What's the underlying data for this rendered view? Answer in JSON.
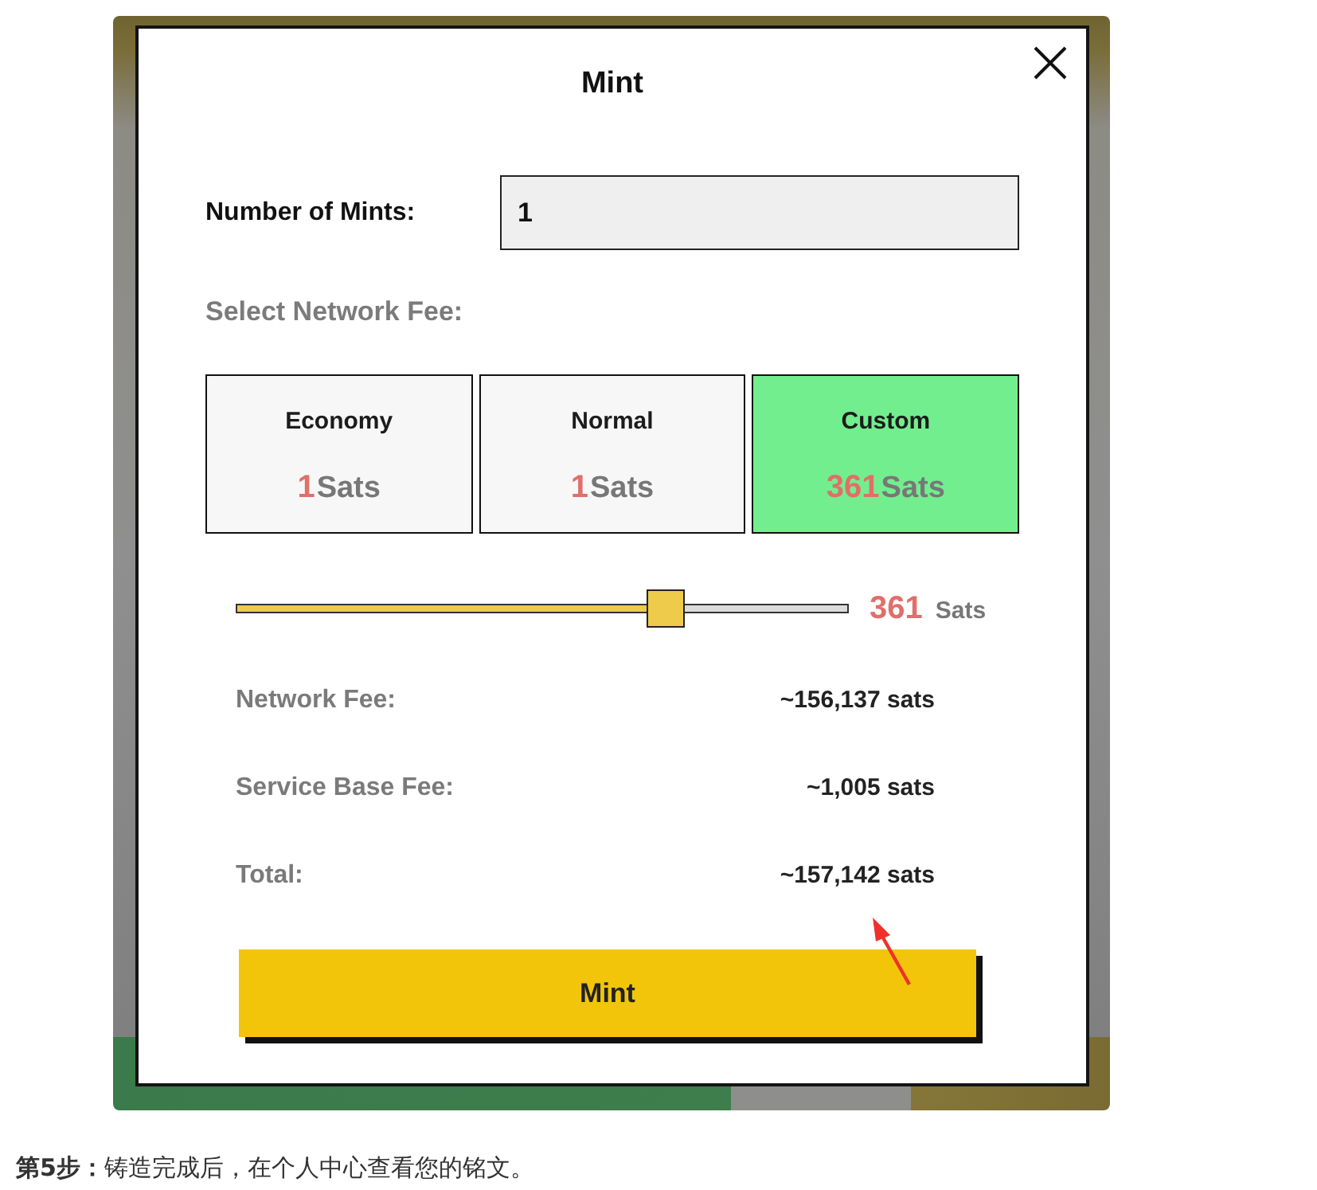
{
  "dialog": {
    "title": "Mint"
  },
  "quantity": {
    "label": "Number of Mints:",
    "value": "1"
  },
  "fee_select": {
    "label": "Select Network Fee:",
    "options": [
      {
        "name": "Economy",
        "amount": "1",
        "unit": "Sats",
        "selected": false
      },
      {
        "name": "Normal",
        "amount": "1",
        "unit": "Sats",
        "selected": false
      },
      {
        "name": "Custom",
        "amount": "361",
        "unit": "Sats",
        "selected": true
      }
    ]
  },
  "custom_fee": {
    "level": 0.7,
    "amount": "361",
    "unit": "Sats"
  },
  "summary": [
    {
      "label": "Network Fee:",
      "value": "~156,137 sats"
    },
    {
      "label": "Service Base Fee:",
      "value": "~1,005 sats"
    },
    {
      "label": "Total:",
      "value": "~157,142 sats"
    }
  ],
  "submit": {
    "label": "Mint"
  },
  "caption": "**第5步：**铸造完成后，在个人中心查看您的铭文。"
}
